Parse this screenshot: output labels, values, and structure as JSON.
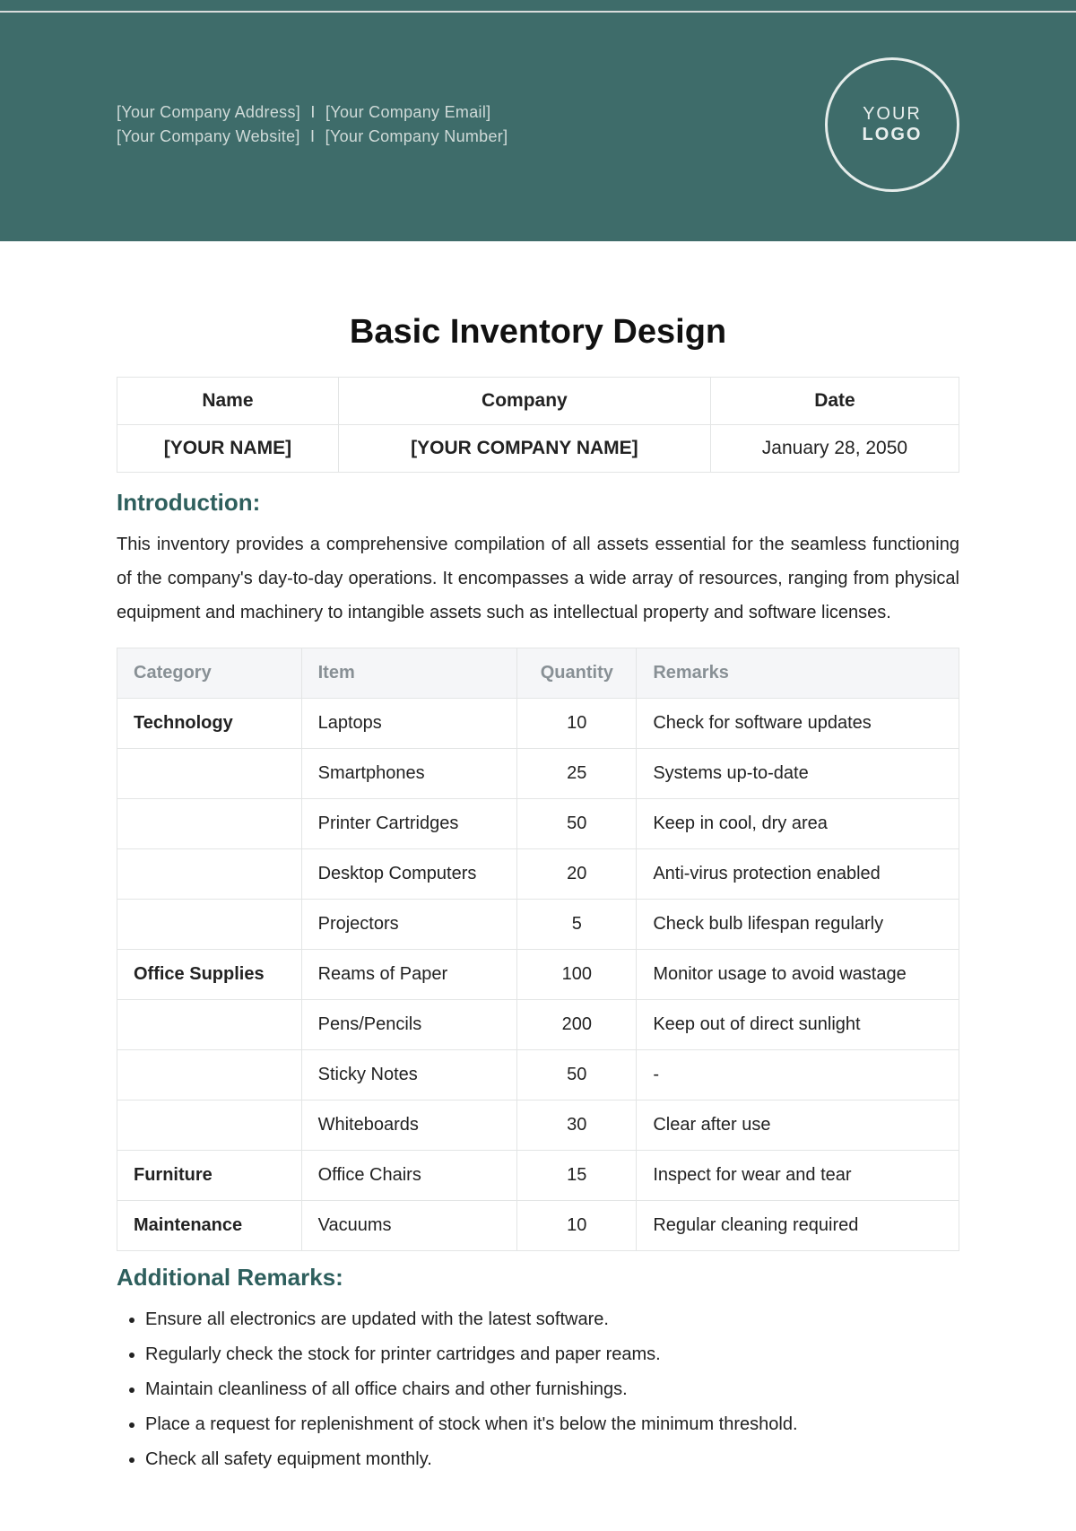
{
  "header": {
    "line1_a": "[Your Company Address]",
    "line1_b": "[Your Company Email]",
    "line2_a": "[Your Company Website]",
    "line2_b": "[Your Company Number]",
    "logo_line1": "YOUR",
    "logo_line2": "LOGO"
  },
  "title": "Basic Inventory Design",
  "meta": {
    "headers": {
      "name": "Name",
      "company": "Company",
      "date": "Date"
    },
    "values": {
      "name": "[YOUR NAME]",
      "company": "[YOUR COMPANY NAME]",
      "date": "January 28, 2050"
    }
  },
  "sections": {
    "introduction_title": "Introduction:",
    "introduction_body": "This inventory provides a comprehensive compilation of all assets essential for the seamless functioning of the company's day-to-day operations. It encompasses a wide array of resources, ranging from physical equipment and machinery to intangible assets such as intellectual property and software licenses.",
    "remarks_title": "Additional Remarks:"
  },
  "inventory": {
    "columns": {
      "category": "Category",
      "item": "Item",
      "quantity": "Quantity",
      "remarks": "Remarks"
    },
    "rows": [
      {
        "category": "Technology",
        "item": "Laptops",
        "quantity": "10",
        "remarks": "Check for software updates"
      },
      {
        "category": "",
        "item": "Smartphones",
        "quantity": "25",
        "remarks": "Systems up-to-date"
      },
      {
        "category": "",
        "item": "Printer Cartridges",
        "quantity": "50",
        "remarks": "Keep in cool, dry area"
      },
      {
        "category": "",
        "item": "Desktop Computers",
        "quantity": "20",
        "remarks": "Anti-virus protection enabled"
      },
      {
        "category": "",
        "item": "Projectors",
        "quantity": "5",
        "remarks": "Check bulb lifespan regularly"
      },
      {
        "category": "Office Supplies",
        "item": "Reams of Paper",
        "quantity": "100",
        "remarks": "Monitor usage to avoid wastage"
      },
      {
        "category": "",
        "item": "Pens/Pencils",
        "quantity": "200",
        "remarks": "Keep out of direct sunlight"
      },
      {
        "category": "",
        "item": "Sticky Notes",
        "quantity": "50",
        "remarks": "-"
      },
      {
        "category": "",
        "item": "Whiteboards",
        "quantity": "30",
        "remarks": "Clear after use"
      },
      {
        "category": "Furniture",
        "item": "Office Chairs",
        "quantity": "15",
        "remarks": "Inspect for wear and tear"
      },
      {
        "category": "Maintenance",
        "item": "Vacuums",
        "quantity": "10",
        "remarks": "Regular cleaning required"
      }
    ]
  },
  "remarks_list": [
    "Ensure all electronics are updated with the latest software.",
    "Regularly check the stock for printer cartridges and paper reams.",
    "Maintain cleanliness of all office chairs and other furnishings.",
    "Place a request for replenishment of stock when it's below the minimum threshold.",
    "Check all safety equipment monthly."
  ]
}
